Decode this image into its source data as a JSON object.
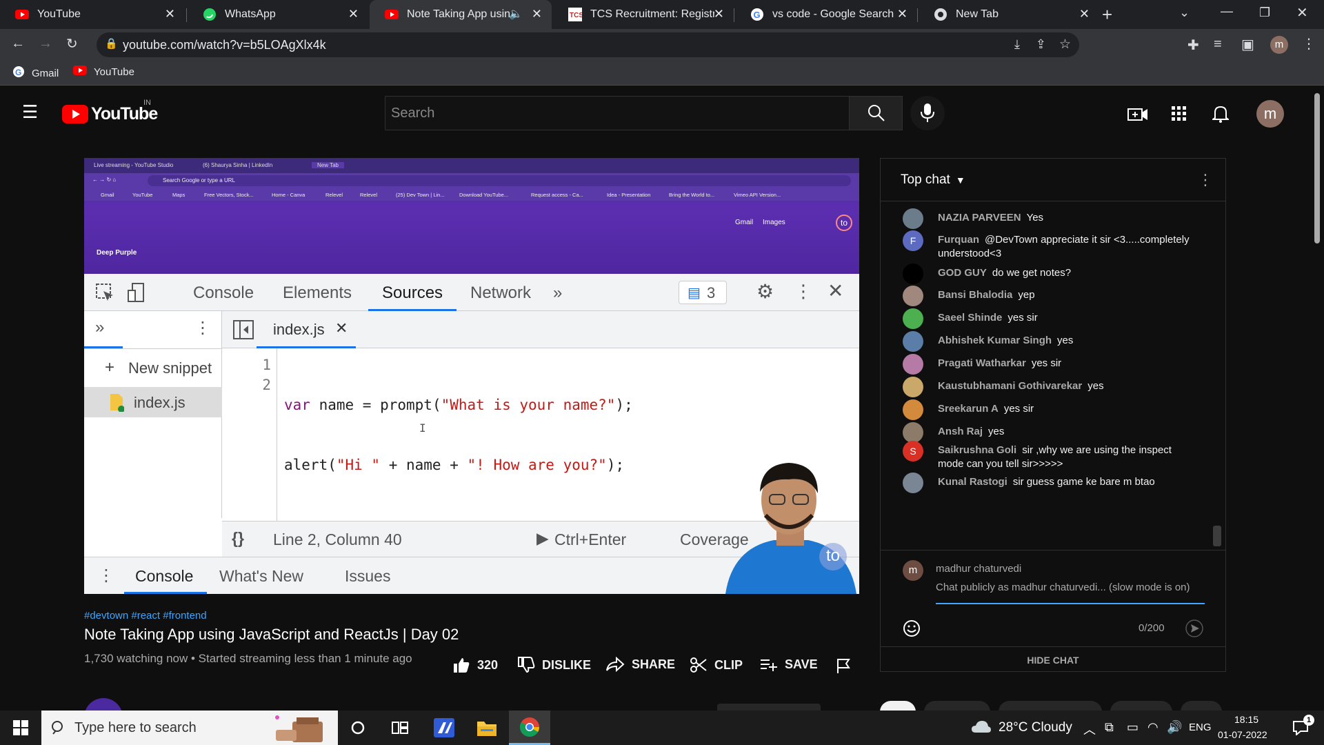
{
  "browser": {
    "tabs": [
      {
        "title": "YouTube",
        "favicon": "youtube-icon"
      },
      {
        "title": "WhatsApp",
        "favicon": "whatsapp-icon"
      },
      {
        "title": "Note Taking App using",
        "favicon": "youtube-icon"
      },
      {
        "title": "TCS Recruitment: Registrati",
        "favicon": "tcs-icon"
      },
      {
        "title": "vs code - Google Search",
        "favicon": "google-icon"
      },
      {
        "title": "New Tab",
        "favicon": "chrome-icon"
      }
    ],
    "url": "youtube.com/watch?v=b5LOAgXlx4k",
    "bookmarks": [
      {
        "label": "Gmail"
      },
      {
        "label": "YouTube"
      }
    ],
    "profile_initial": "m"
  },
  "youtube": {
    "logo_text": "YouTube",
    "region": "IN",
    "search_placeholder": "Search",
    "avatar_initial": "m"
  },
  "video_frame": {
    "inner_tabs": [
      "Live streaming - YouTube Studio",
      "(6) Shaurya Sinha | LinkedIn",
      "New Tab"
    ],
    "inner_url": "Search Google or type a URL",
    "inner_bookmarks": [
      "Gmail",
      "YouTube",
      "Maps",
      "Free Vectors, Stock...",
      "Home - Canva",
      "Relevel",
      "Relevel",
      "(25) Dev Town | Lin...",
      "Download YouTube...",
      "Request access - Ca...",
      "Idea - Presentation",
      "Bring the World to...",
      "Vimeo API Version..."
    ],
    "gmail": "Gmail",
    "images": "Images",
    "theme": "Deep Purple",
    "devtools": {
      "tabs": [
        "Console",
        "Elements",
        "Sources",
        "Network"
      ],
      "selected_tab": "Sources",
      "issues_count": "3",
      "file_tab": "index.js",
      "new_snippet": "New snippet",
      "snippet_file": "index.js",
      "line_numbers": [
        "1",
        "2"
      ],
      "code_lines": [
        "var name = prompt(\"What is your name?\");",
        "alert(\"Hi \" + name + \"! How are you?\");"
      ],
      "status_position": "Line 2, Column 40",
      "run_hint": "Ctrl+Enter",
      "coverage": "Coverage",
      "drawer_tabs": [
        "Console",
        "What's New",
        "Issues"
      ]
    },
    "logo_badge": "to"
  },
  "video": {
    "hashtags": "#devtown #react #frontend",
    "title": "Note Taking App using JavaScript and ReactJs | Day 02",
    "stats": "1,730 watching now • Started streaming less than 1 minute ago",
    "likes": "320",
    "dislike": "DISLIKE",
    "share": "SHARE",
    "clip": "CLIP",
    "save": "SAVE"
  },
  "chat": {
    "header": "Top chat",
    "messages": [
      {
        "author": "NAZIA PARVEEN",
        "text": "Yes",
        "avatar_color": "#6b7c8a"
      },
      {
        "author": "Furquan",
        "text": "@DevTown appreciate it sir <3.....completely understood<3",
        "avatar_color": "#5c6bc0",
        "initial": "F"
      },
      {
        "author": "GOD GUY",
        "text": "do we get notes?",
        "avatar_color": "#000000"
      },
      {
        "author": "Bansi Bhalodia",
        "text": "yep",
        "avatar_color": "#a1887f"
      },
      {
        "author": "Saeel Shinde",
        "text": "yes sir",
        "avatar_color": "#4caf50"
      },
      {
        "author": "Abhishek Kumar Singh",
        "text": "yes",
        "avatar_color": "#5b7ea8"
      },
      {
        "author": "Pragati Watharkar",
        "text": "yes sir",
        "avatar_color": "#b57ba6"
      },
      {
        "author": "Kaustubhamani Gothivarekar",
        "text": "yes",
        "avatar_color": "#c9a86a"
      },
      {
        "author": "Sreekarun A",
        "text": "yes sir",
        "avatar_color": "#d48a3c"
      },
      {
        "author": "Ansh Raj",
        "text": "yes",
        "avatar_color": "#8d7b6a"
      },
      {
        "author": "Saikrushna Goli",
        "text": "sir ,why we are using the inspect mode can you tell sir>>>>>",
        "avatar_color": "#d93025",
        "initial": "S"
      },
      {
        "author": "Kunal Rastogi",
        "text": "sir guess game ke bare m btao",
        "avatar_color": "#7a8694"
      }
    ],
    "input_user": "madhur chaturvedi",
    "input_user_initial": "m",
    "input_placeholder": "Chat publicly as madhur chaturvedi... (slow mode is on)",
    "char_count": "0/200",
    "hide_chat": "HIDE CHAT"
  },
  "taskbar": {
    "search_placeholder": "Type here to search",
    "weather": "28°C Cloudy",
    "language": "ENG",
    "time": "18:15",
    "date": "01-07-2022"
  }
}
